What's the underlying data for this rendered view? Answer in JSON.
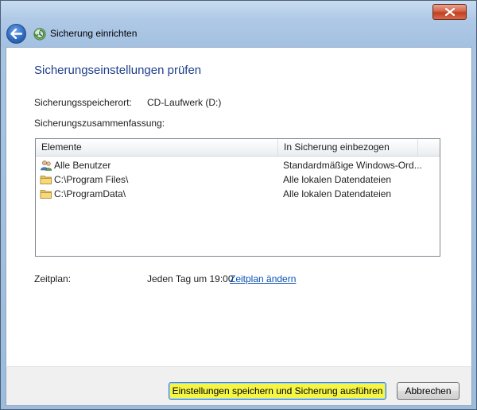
{
  "window": {
    "title": "Sicherung einrichten",
    "close_symbol": "×"
  },
  "page": {
    "heading": "Sicherungseinstellungen prüfen",
    "location_label": "Sicherungsspeicherort:",
    "location_value": "CD-Laufwerk (D:)",
    "summary_label": "Sicherungszusammenfassung:",
    "schedule_label": "Zeitplan:",
    "schedule_value": "Jeden Tag um 19:00",
    "schedule_link": "Zeitplan ändern"
  },
  "table": {
    "columns": [
      "Elemente",
      "In Sicherung einbezogen"
    ],
    "rows": [
      {
        "icon": "users-icon",
        "item": "Alle Benutzer",
        "included": "Standardmäßige Windows-Ord..."
      },
      {
        "icon": "folder-icon",
        "item": "C:\\Program Files\\",
        "included": "Alle lokalen Datendateien"
      },
      {
        "icon": "folder-icon",
        "item": "C:\\ProgramData\\",
        "included": "Alle lokalen Datendateien"
      }
    ]
  },
  "buttons": {
    "save": "Einstellungen speichern und Sicherung ausführen",
    "cancel": "Abbrechen"
  },
  "colors": {
    "heading": "#1e3e8a",
    "link": "#0a4fb3",
    "primary_button_highlight": "#f5f546"
  }
}
